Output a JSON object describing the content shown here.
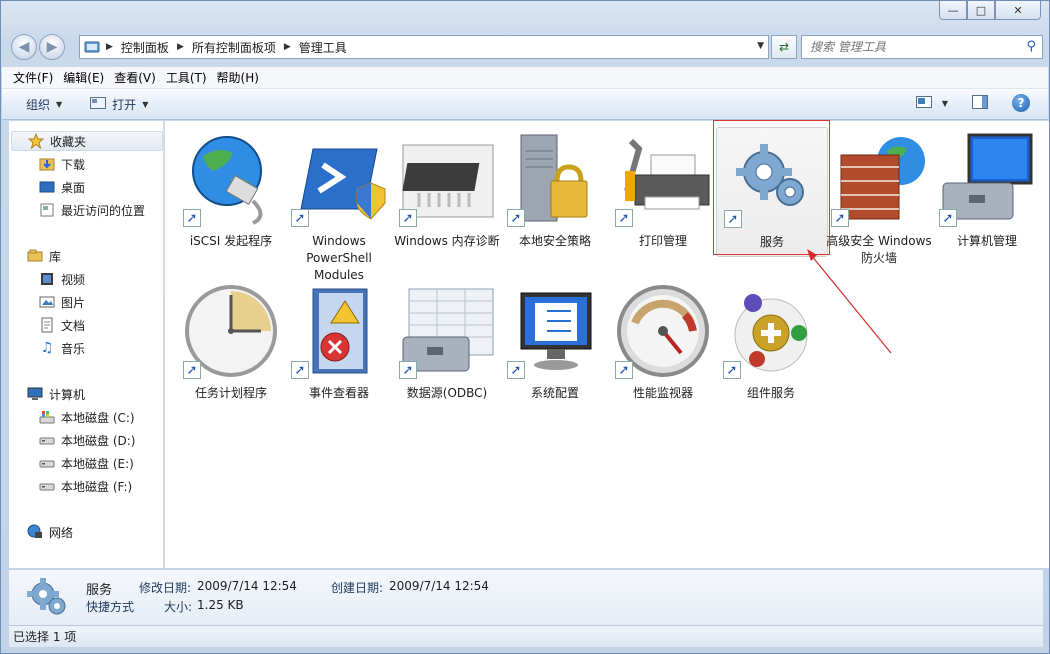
{
  "window": {
    "caption_buttons": {
      "minimize": "—",
      "maximize": "□",
      "close": "✕"
    }
  },
  "address": {
    "segments": [
      "控制面板",
      "所有控制面板项",
      "管理工具"
    ],
    "search_placeholder": "搜索 管理工具"
  },
  "menu": [
    "文件(F)",
    "编辑(E)",
    "查看(V)",
    "工具(T)",
    "帮助(H)"
  ],
  "toolbar": {
    "organize": "组织",
    "open": "打开",
    "help": "?"
  },
  "nav": {
    "favorites": "收藏夹",
    "downloads": "下载",
    "desktop": "桌面",
    "recent": "最近访问的位置",
    "libraries": "库",
    "videos": "视频",
    "pictures": "图片",
    "documents": "文档",
    "music": "音乐",
    "computer": "计算机",
    "disk_c": "本地磁盘 (C:)",
    "disk_d": "本地磁盘 (D:)",
    "disk_e": "本地磁盘 (E:)",
    "disk_f": "本地磁盘 (F:)",
    "network": "网络"
  },
  "items": [
    {
      "label": "iSCSI 发起程序",
      "icon": "globe-network-icon"
    },
    {
      "label": "Windows PowerShell Modules",
      "icon": "powershell-icon"
    },
    {
      "label": "Windows 内存诊断",
      "icon": "memory-chip-icon"
    },
    {
      "label": "本地安全策略",
      "icon": "server-lock-icon"
    },
    {
      "label": "打印管理",
      "icon": "printer-icon"
    },
    {
      "label": "服务",
      "icon": "gears-icon",
      "selected": true
    },
    {
      "label": "高级安全 Windows 防火墙",
      "icon": "firewall-icon"
    },
    {
      "label": "计算机管理",
      "icon": "computer-toolbox-icon"
    },
    {
      "label": "任务计划程序",
      "icon": "clock-icon"
    },
    {
      "label": "事件查看器",
      "icon": "event-log-icon"
    },
    {
      "label": "数据源(ODBC)",
      "icon": "database-toolbox-icon"
    },
    {
      "label": "系统配置",
      "icon": "monitor-checklist-icon"
    },
    {
      "label": "性能监视器",
      "icon": "gauge-icon"
    },
    {
      "label": "组件服务",
      "icon": "component-services-icon"
    }
  ],
  "details": {
    "name": "服务",
    "type": "快捷方式",
    "modified_label": "修改日期:",
    "modified_value": "2009/7/14 12:54",
    "created_label": "创建日期:",
    "created_value": "2009/7/14 12:54",
    "size_label": "大小:",
    "size_value": "1.25 KB"
  },
  "status": {
    "text": "已选择 1 项"
  }
}
